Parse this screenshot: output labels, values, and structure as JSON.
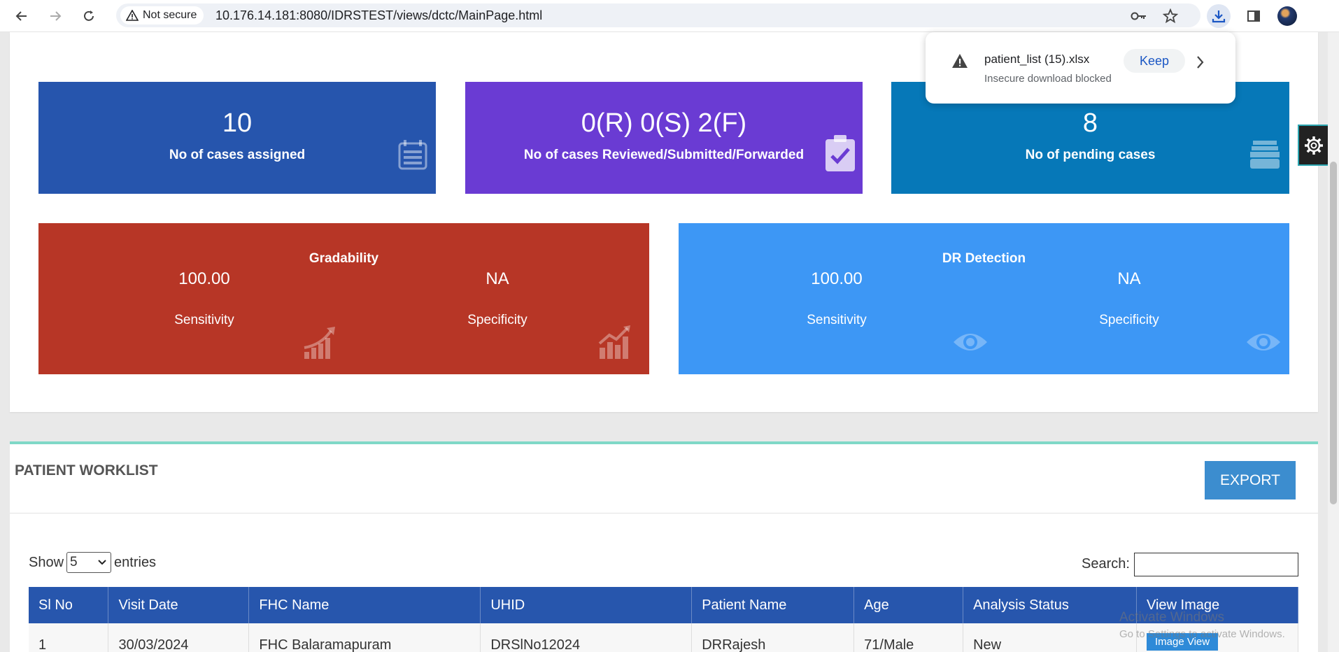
{
  "browser": {
    "security_label": "Not secure",
    "url": "10.176.14.181:8080/IDRSTEST/views/dctc/MainPage.html"
  },
  "download": {
    "filename": "patient_list (15).xlsx",
    "status": "Insecure download blocked",
    "keep_label": "Keep"
  },
  "stats": [
    {
      "value": "10",
      "label": "No of cases assigned",
      "color": "#2655ad"
    },
    {
      "value": "0(R) 0(S) 2(F)",
      "label": "No of cases Reviewed/Submitted/Forwarded",
      "color": "#6a3bd3"
    },
    {
      "value": "8",
      "label": "No of pending cases",
      "color": "#0678b8"
    }
  ],
  "metrics": [
    {
      "title": "Gradability",
      "color": "#b73626",
      "sensitivity_value": "100.00",
      "sensitivity_label": "Sensitivity",
      "specificity_value": "NA",
      "specificity_label": "Specificity"
    },
    {
      "title": "DR Detection",
      "color": "#3d97f5",
      "sensitivity_value": "100.00",
      "sensitivity_label": "Sensitivity",
      "specificity_value": "NA",
      "specificity_label": "Specificity"
    }
  ],
  "worklist": {
    "title": "PATIENT WORKLIST",
    "export_label": "EXPORT",
    "show_label": "Show",
    "entries_value": "5",
    "entries_label": "entries",
    "search_label": "Search:",
    "columns": [
      "Sl No",
      "Visit Date",
      "FHC Name",
      "UHID",
      "Patient Name",
      "Age",
      "Analysis Status",
      "View Image"
    ],
    "rows": [
      {
        "sl": "1",
        "visit_date": "30/03/2024",
        "fhc": "FHC Balaramapuram",
        "uhid": "DRSlNo12024",
        "patient": "DRRajesh",
        "age": "71/Male",
        "status": "New",
        "action": "Image View"
      }
    ]
  },
  "watermark": {
    "line1": "Activate Windows",
    "line2": "Go to Settings to activate Windows."
  }
}
